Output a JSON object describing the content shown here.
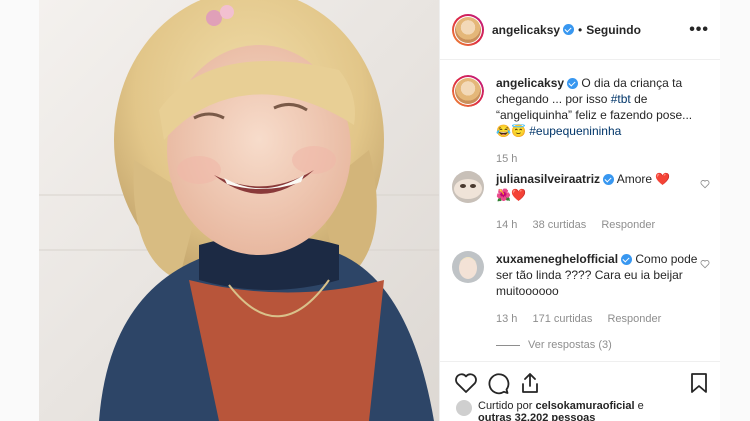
{
  "post": {
    "username": "angelicaksy",
    "follow_status": "Seguindo",
    "caption_text": "O dia da criança ta chegando ... por isso",
    "caption_tag": "#tbt",
    "caption_text2": "de “angeliquinha” feliz e fazendo pose...",
    "caption_emoji": "😂😇",
    "caption_tag2": "#eupequenininha",
    "caption_time": "15 h",
    "separator": "•",
    "more_icon": "•••"
  },
  "comments": [
    {
      "username": "julianasilveiraatriz",
      "text": "Amore",
      "emoji": "❤️",
      "line2": "🌺❤️",
      "time": "14 h",
      "likes": "38 curtidas",
      "reply": "Responder"
    },
    {
      "username": "xuxameneghelofficial",
      "text": "Como pode ser tão linda ???? Cara eu ia beijar muitoooooo",
      "time": "13 h",
      "likes": "171 curtidas",
      "reply": "Responder",
      "view_replies": "Ver respostas (3)"
    }
  ],
  "liked_by": {
    "prefix": "Curtido por",
    "user": "celsokamuraoficial",
    "suffix": "e",
    "others": "outras 32.202 pessoas"
  },
  "colors": {
    "accent": "#3897f0",
    "heart": "#ed4956",
    "text": "#262626",
    "muted": "#8e8e8e"
  },
  "icons": [
    "heart-icon",
    "comment-icon",
    "share-icon",
    "bookmark-icon",
    "chevron-right-icon",
    "verified-icon",
    "more-options-icon"
  ]
}
